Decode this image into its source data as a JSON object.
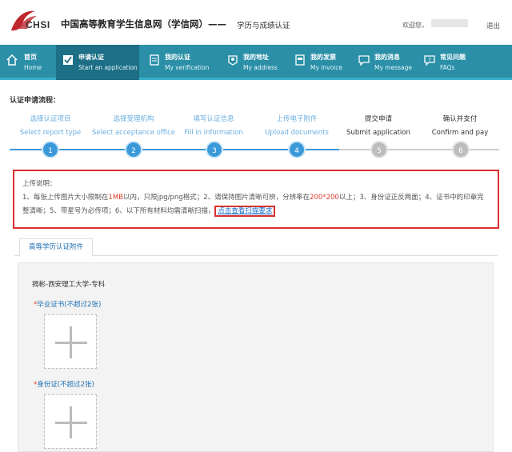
{
  "header": {
    "logo_text": "CHSI",
    "site_title": "中国高等教育学生信息网（学信网）——",
    "site_subtitle": "学历与成绩认证",
    "welcome": "欢迎您，",
    "logout": "退出",
    "brand_color": "#c0272d"
  },
  "nav": {
    "items": [
      {
        "zh": "首页",
        "en": "Home",
        "icon": "home-icon"
      },
      {
        "zh": "申请认证",
        "en": "Start an application",
        "icon": "checkbox-icon"
      },
      {
        "zh": "我的认证",
        "en": "My verification",
        "icon": "document-icon"
      },
      {
        "zh": "我的地址",
        "en": "My address",
        "icon": "location-icon"
      },
      {
        "zh": "我的发票",
        "en": "My invoice",
        "icon": "invoice-icon"
      },
      {
        "zh": "我的消息",
        "en": "My message",
        "icon": "message-icon"
      },
      {
        "zh": "常见问题",
        "en": "FAQs",
        "icon": "question-icon"
      }
    ],
    "bg_color": "#2a8fa7",
    "active_color": "#1c6f86"
  },
  "process": {
    "title": "认证申请流程：",
    "steps": [
      {
        "zh": "选择认证项目",
        "en": "Select report type",
        "num": "1"
      },
      {
        "zh": "选择受理机构",
        "en": "Select acceptance office",
        "num": "2"
      },
      {
        "zh": "填写认证信息",
        "en": "Fill in information",
        "num": "3"
      },
      {
        "zh": "上传电子附件",
        "en": "Upload documents",
        "num": "4"
      },
      {
        "zh": "提交申请",
        "en": "Submit application",
        "num": "5"
      },
      {
        "zh": "确认并支付",
        "en": "Confirm and pay",
        "num": "6"
      }
    ],
    "current_step": 4,
    "done_color": "#3a9ad9"
  },
  "instructions": {
    "title": "上传说明：",
    "p1": "1、每张上传图片大小限制在",
    "size_limit": "1MB",
    "p2": "以内，只限jpg/png格式；2、请保持图片清晰可辨，分辨率在",
    "resolution": "200*200",
    "p3": "以上；3、身份证正反两面；4、证书中的印章完整清晰；5、带星号为必传项；6、以下所有材料均需清晰扫描，",
    "link": "点击查看扫描要求"
  },
  "panel": {
    "tab_label": "高等学历认证附件",
    "record": "揭彬-西安理工大学-专科",
    "sections": [
      {
        "required_mark": "*",
        "label": "毕业证书(不超过2张)"
      },
      {
        "required_mark": "*",
        "label": "身份证(不超过2张)"
      }
    ]
  }
}
